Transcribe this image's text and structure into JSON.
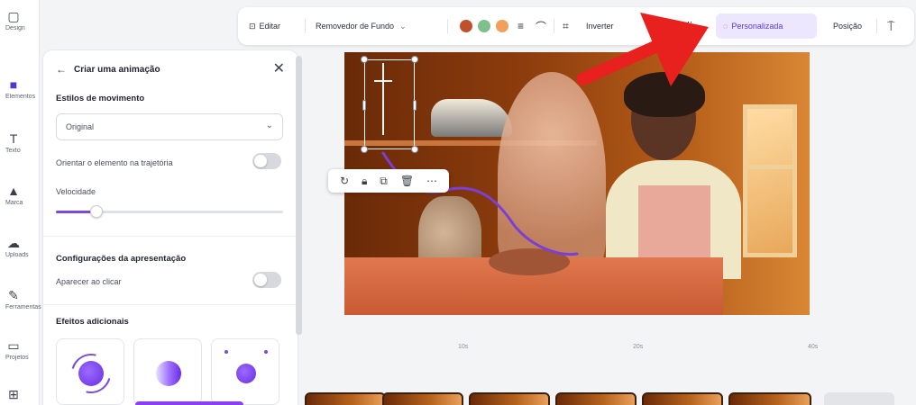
{
  "rail": {
    "items": [
      {
        "label": "Design",
        "icon": "layout-icon"
      },
      {
        "label": "Elementos",
        "icon": "elements-icon"
      },
      {
        "label": "Texto",
        "icon": "text-icon"
      },
      {
        "label": "Marca",
        "icon": "brand-icon"
      },
      {
        "label": "Uploads",
        "icon": "upload-icon"
      },
      {
        "label": "Ferramentas",
        "icon": "draw-icon"
      },
      {
        "label": "Projetos",
        "icon": "folder-icon"
      },
      {
        "label": "Apps",
        "icon": "apps-icon"
      }
    ]
  },
  "panel": {
    "title": "Criar uma animação",
    "motion_styles_heading": "Estilos de movimento",
    "motion_style_selected": "Original",
    "orient_label": "Orientar o elemento na trajetória",
    "speed_label": "Velocidade",
    "speed_value": 0.18,
    "presentation_heading": "Configurações da apresentação",
    "appear_on_click_label": "Aparecer ao clicar",
    "extra_effects_heading": "Efeitos adicionais"
  },
  "toolbar": {
    "edit_label": "Editar",
    "bg_remover_label": "Removedor de Fundo",
    "invert_label": "Inverter",
    "custom_label": "Personalizada",
    "position_label": "Posição",
    "swatches": [
      "#c0502a",
      "#7fbf8a",
      "#f0a05a"
    ]
  },
  "timeline": {
    "ticks": [
      "10s",
      "20s",
      "40s"
    ]
  },
  "colors": {
    "accent": "#7b4ad8",
    "arrow": "#e8201e"
  }
}
